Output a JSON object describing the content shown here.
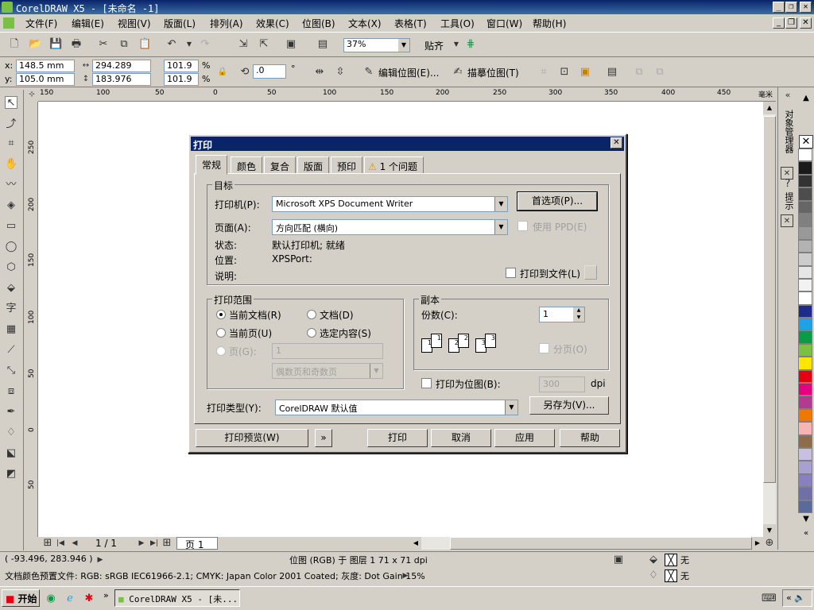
{
  "window": {
    "title": "CorelDRAW X5 - [未命名 -1]",
    "min": "_",
    "max": "❐",
    "close": "✕"
  },
  "menu": [
    "文件(F)",
    "编辑(E)",
    "视图(V)",
    "版面(L)",
    "排列(A)",
    "效果(C)",
    "位图(B)",
    "文本(X)",
    "表格(T)",
    "工具(O)",
    "窗口(W)",
    "帮助(H)"
  ],
  "toolbar": {
    "zoom": "37%",
    "align_label": "贴齐"
  },
  "propbar": {
    "x": "148.5 mm",
    "y": "105.0 mm",
    "w": "294.289 mm",
    "h": "183.976 mm",
    "sx": "101.9",
    "sy": "101.9",
    "pct": "%",
    "angle": ".0",
    "deg": "°",
    "edit_bitmap": "编辑位图(E)...",
    "trace_bitmap": "描摹位图(T)"
  },
  "ruler": {
    "h_ticks": [
      "150",
      "100",
      "50",
      "0",
      "50",
      "100",
      "150",
      "200",
      "250",
      "300",
      "350",
      "400",
      "450"
    ],
    "h_unit": "毫米",
    "v_ticks": [
      "250",
      "200",
      "150",
      "100",
      "50",
      "0",
      "50"
    ]
  },
  "pagenav": {
    "pages": "1 / 1",
    "tab": "页 1"
  },
  "palette": [
    "#ffffff",
    "#1a1a1a",
    "#333333",
    "#4d4d4d",
    "#666666",
    "#808080",
    "#999999",
    "#b3b3b3",
    "#cccccc",
    "#e6e6e6",
    "#f2f2f2",
    "#ffffff",
    "#1c2b8c",
    "#1ea1e6",
    "#0b9a45",
    "#7ac143",
    "#ffe600",
    "#e60012",
    "#e4007f",
    "#b23a8f",
    "#ee7800",
    "#f7b4b4",
    "#8e6b4b",
    "#c8c0e0",
    "#a8a0d0",
    "#8880c0",
    "#7070a8",
    "#5a6a9a"
  ],
  "status": {
    "coords": "( -93.496, 283.946 )",
    "center": "位图 (RGB) 于 图层 1 71 x 71 dpi",
    "fill_none": "无",
    "outline_none": "无",
    "profile": "文档颜色预置文件: RGB: sRGB IEC61966-2.1; CMYK: Japan Color 2001 Coated; 灰度: Dot Gain 15%"
  },
  "taskbar": {
    "start": "开始",
    "app": "CorelDRAW X5 - [未..."
  },
  "dialog": {
    "title": "打印",
    "tabs": [
      "常规",
      "颜色",
      "复合",
      "版面",
      "预印",
      "1 个问题"
    ],
    "target_group": "目标",
    "printer_label": "打印机(P):",
    "printer_value": "Microsoft XPS Document Writer",
    "prefs_button": "首选项(P)...",
    "page_label": "页面(A):",
    "page_value": "方向匹配 (横向)",
    "use_ppd": "使用 PPD(E)",
    "status_label": "状态:",
    "status_value": "默认打印机; 就绪",
    "location_label": "位置:",
    "location_value": "XPSPort:",
    "comment_label": "说明:",
    "print_to_file": "打印到文件(L)",
    "range_group": "打印范围",
    "current_doc": "当前文档(R)",
    "documents": "文档(D)",
    "current_page": "当前页(U)",
    "selection": "选定内容(S)",
    "pages": "页(G):",
    "pages_value": "1",
    "even_odd": "偶数页和奇数页",
    "copies_group": "副本",
    "copies_label": "份数(C):",
    "copies_value": "1",
    "collate": "分页(O)",
    "print_as_bitmap": "打印为位图(B):",
    "dpi_value": "300",
    "dpi": "dpi",
    "print_type_label": "打印类型(Y):",
    "print_type_value": "CorelDRAW 默认值",
    "save_as": "另存为(V)...",
    "preview_button": "打印预览(W)",
    "print_button": "打印",
    "cancel_button": "取消",
    "apply_button": "应用",
    "help_button": "帮助"
  },
  "docker": {
    "label1": "对象管理器",
    "label2": "提示"
  }
}
